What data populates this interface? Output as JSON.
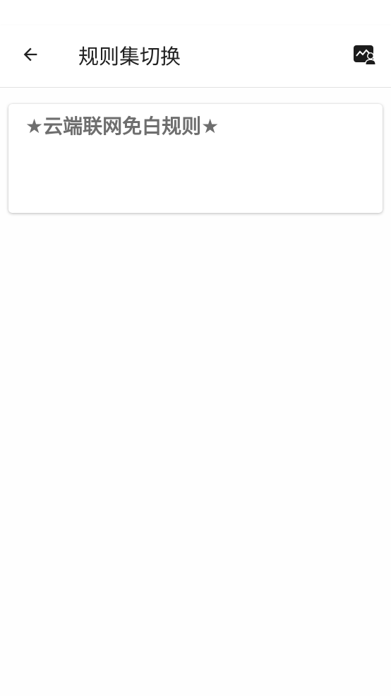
{
  "header": {
    "title": "规则集切换",
    "back_icon": "arrow-left-icon",
    "action_icon": "image-person-icon"
  },
  "rules": [
    {
      "label": "★云端联网免白规则★"
    }
  ],
  "colors": {
    "title_text": "#212121",
    "card_text": "#6e6e6e",
    "background": "#fefefe"
  }
}
